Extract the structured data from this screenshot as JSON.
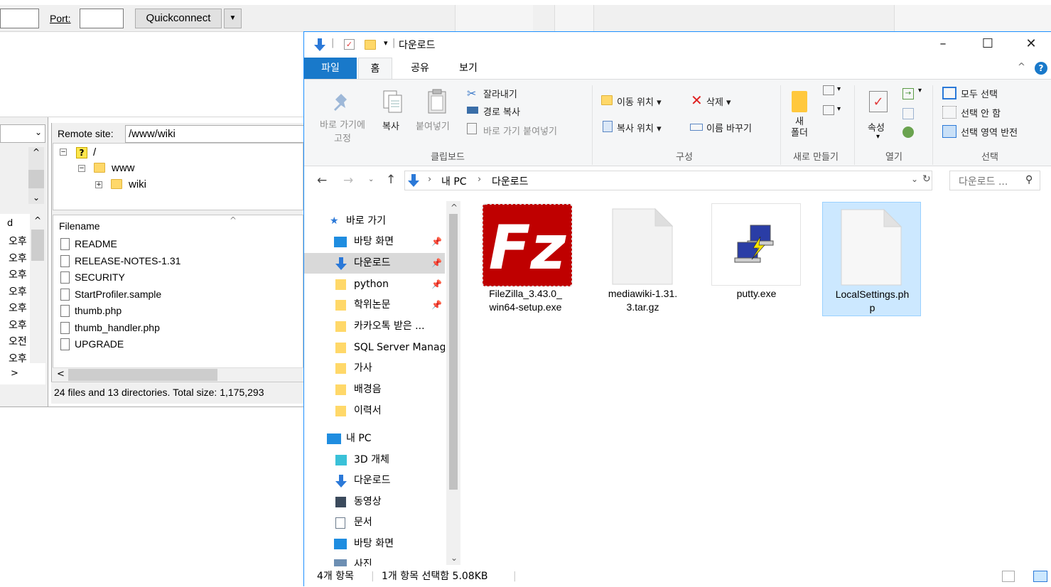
{
  "filezilla": {
    "port_label": "Port:",
    "quickconnect_label": "Quickconnect",
    "remote_site_label": "Remote site:",
    "remote_path": "/www/wiki",
    "tree": {
      "root": "/",
      "www": "www",
      "wiki": "wiki"
    },
    "filename_header": "Filename",
    "files": [
      "README",
      "RELEASE-NOTES-1.31",
      "SECURITY",
      "StartProfiler.sample",
      "thumb.php",
      "thumb_handler.php",
      "UPGRADE"
    ],
    "left_times": [
      "오후",
      "오후",
      "오후",
      "오후",
      "오후",
      "오후",
      "오전",
      "오후"
    ],
    "status": "24 files and 13 directories. Total size: 1,175,293"
  },
  "explorer": {
    "title": "다운로드",
    "tabs": [
      "파일",
      "홈",
      "공유",
      "보기"
    ],
    "ribbon": {
      "pin_label_1": "바로 가기에",
      "pin_label_2": "고정",
      "copy": "복사",
      "paste": "붙여넣기",
      "cut": "잘라내기",
      "copy_path": "경로 복사",
      "paste_shortcut": "바로 가기 붙여넣기",
      "move_to": "이동 위치",
      "copy_to": "복사 위치",
      "delete": "삭제",
      "rename": "이름 바꾸기",
      "new_folder_1": "새",
      "new_folder_2": "폴더",
      "properties": "속성",
      "select_all": "모두 선택",
      "select_none": "선택 안 함",
      "invert_selection": "선택 영역 반전",
      "group_clipboard": "클립보드",
      "group_organize": "구성",
      "group_new": "새로 만들기",
      "group_open": "열기",
      "group_select": "선택"
    },
    "address": {
      "crumb_pc": "내 PC",
      "crumb_downloads": "다운로드",
      "search_placeholder": "다운로드 ..."
    },
    "nav": {
      "quick_access": "바로 가기",
      "desktop": "바탕 화면",
      "downloads": "다운로드",
      "python": "python",
      "thesis": "학위논문",
      "kakaotalk": "카카오톡 받은 ...",
      "sql": "SQL Server Manag",
      "lyrics": "가사",
      "bgm": "배경음",
      "resume": "이력서",
      "my_pc": "내 PC",
      "objects3d": "3D 개체",
      "downloads2": "다운로드",
      "videos": "동영상",
      "documents": "문서",
      "desktop2": "바탕 화면",
      "pictures": "사진"
    },
    "files": [
      {
        "name_line1": "FileZilla_3.43.0_",
        "name_line2": "win64-setup.exe",
        "icon": "filezilla-icon"
      },
      {
        "name_line1": "mediawiki-1.31.",
        "name_line2": "3.tar.gz",
        "icon": "blank-file-icon"
      },
      {
        "name_line1": "putty.exe",
        "name_line2": "",
        "icon": "putty-icon"
      },
      {
        "name_line1": "LocalSettings.ph",
        "name_line2": "p",
        "icon": "blank-file-icon"
      }
    ],
    "status": {
      "count": "4개 항목",
      "selected": "1개 항목 선택함 5.08KB"
    }
  }
}
